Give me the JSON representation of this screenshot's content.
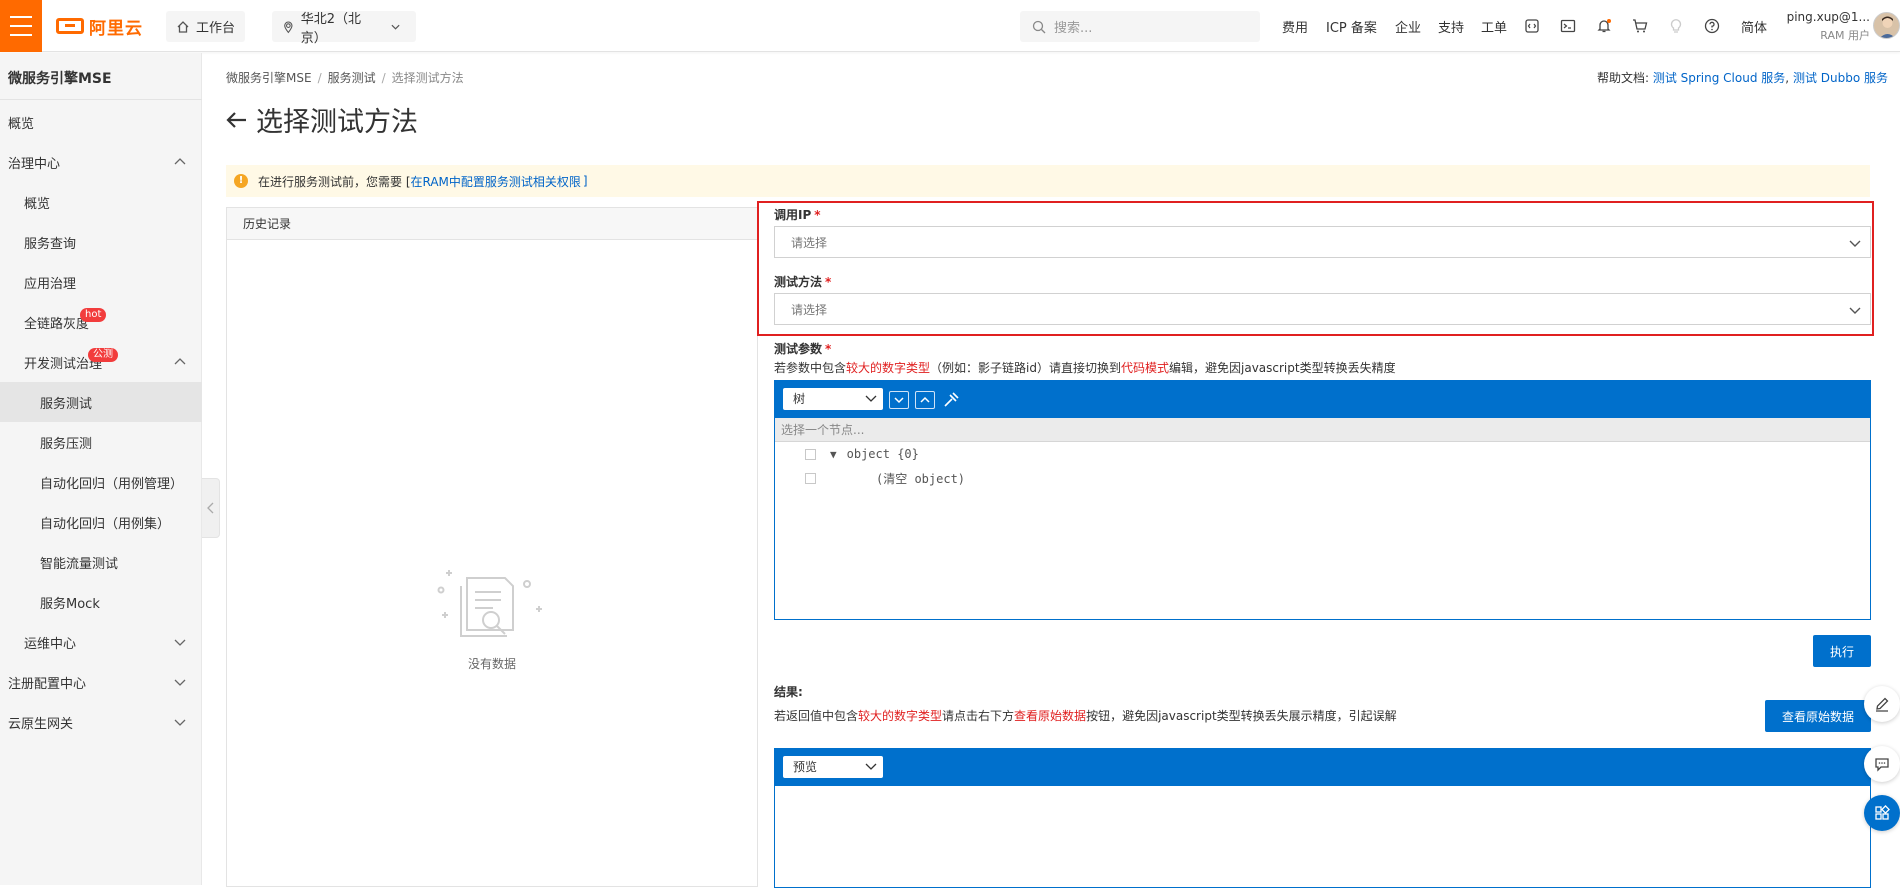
{
  "topbar": {
    "logo_text": "阿里云",
    "workbench": "工作台",
    "region": "华北2（北京）",
    "search_placeholder": "搜索...",
    "links": [
      "费用",
      "ICP 备案",
      "企业",
      "支持",
      "工单"
    ],
    "lang": "简体",
    "user_name": "ping.xup@1...",
    "user_role": "RAM 用户"
  },
  "sidebar": {
    "title": "微服务引擎MSE",
    "items": [
      {
        "label": "概览"
      },
      {
        "label": "治理中心"
      },
      {
        "label": "概览"
      },
      {
        "label": "服务查询"
      },
      {
        "label": "应用治理"
      },
      {
        "label": "全链路灰度",
        "badge": "hot"
      },
      {
        "label": "开发测试治理",
        "badge": "公测"
      },
      {
        "label": "服务测试"
      },
      {
        "label": "服务压测"
      },
      {
        "label": "自动化回归（用例管理）"
      },
      {
        "label": "自动化回归（用例集）"
      },
      {
        "label": "智能流量测试"
      },
      {
        "label": "服务Mock"
      },
      {
        "label": "运维中心"
      },
      {
        "label": "注册配置中心"
      },
      {
        "label": "云原生网关"
      }
    ]
  },
  "breadcrumb": [
    "微服务引擎MSE",
    "服务测试",
    "选择测试方法"
  ],
  "help": {
    "label": "帮助文档:",
    "link1": "测试 Spring Cloud 服务",
    "sep": ",",
    "link2": "测试 Dubbo 服务"
  },
  "page_title": "选择测试方法",
  "alert": {
    "text": "在进行服务测试前，您需要 [",
    "link": "在RAM中配置服务测试相关权限",
    "tail": "]"
  },
  "history": {
    "header": "历史记录",
    "empty": "没有数据"
  },
  "form": {
    "ip_label": "调用IP",
    "ip_placeholder": "请选择",
    "method_label": "测试方法",
    "method_placeholder": "请选择",
    "params_label": "测试参数",
    "params_note": {
      "a": "若参数中包含",
      "b": "较大的数字类型",
      "c": "（例如：影子链路id）请直接切换到",
      "d": "代码模式",
      "e": "编辑，避免因javascript类型转换丢失精度"
    },
    "editor_mode": "树",
    "editor_nav": "选择一个节点...",
    "tree_root": "object {0}",
    "tree_empty": "(清空 object)",
    "execute": "执行"
  },
  "result": {
    "label": "结果:",
    "note": {
      "a": "若返回值中包含",
      "b": "较大的数字类型",
      "c": "请点击右下方",
      "d": "查看原始数据",
      "e": "按钮，避免因javascript类型转换丢失展示精度，引起误解"
    },
    "view_raw": "查看原始数据",
    "mode": "预览"
  }
}
